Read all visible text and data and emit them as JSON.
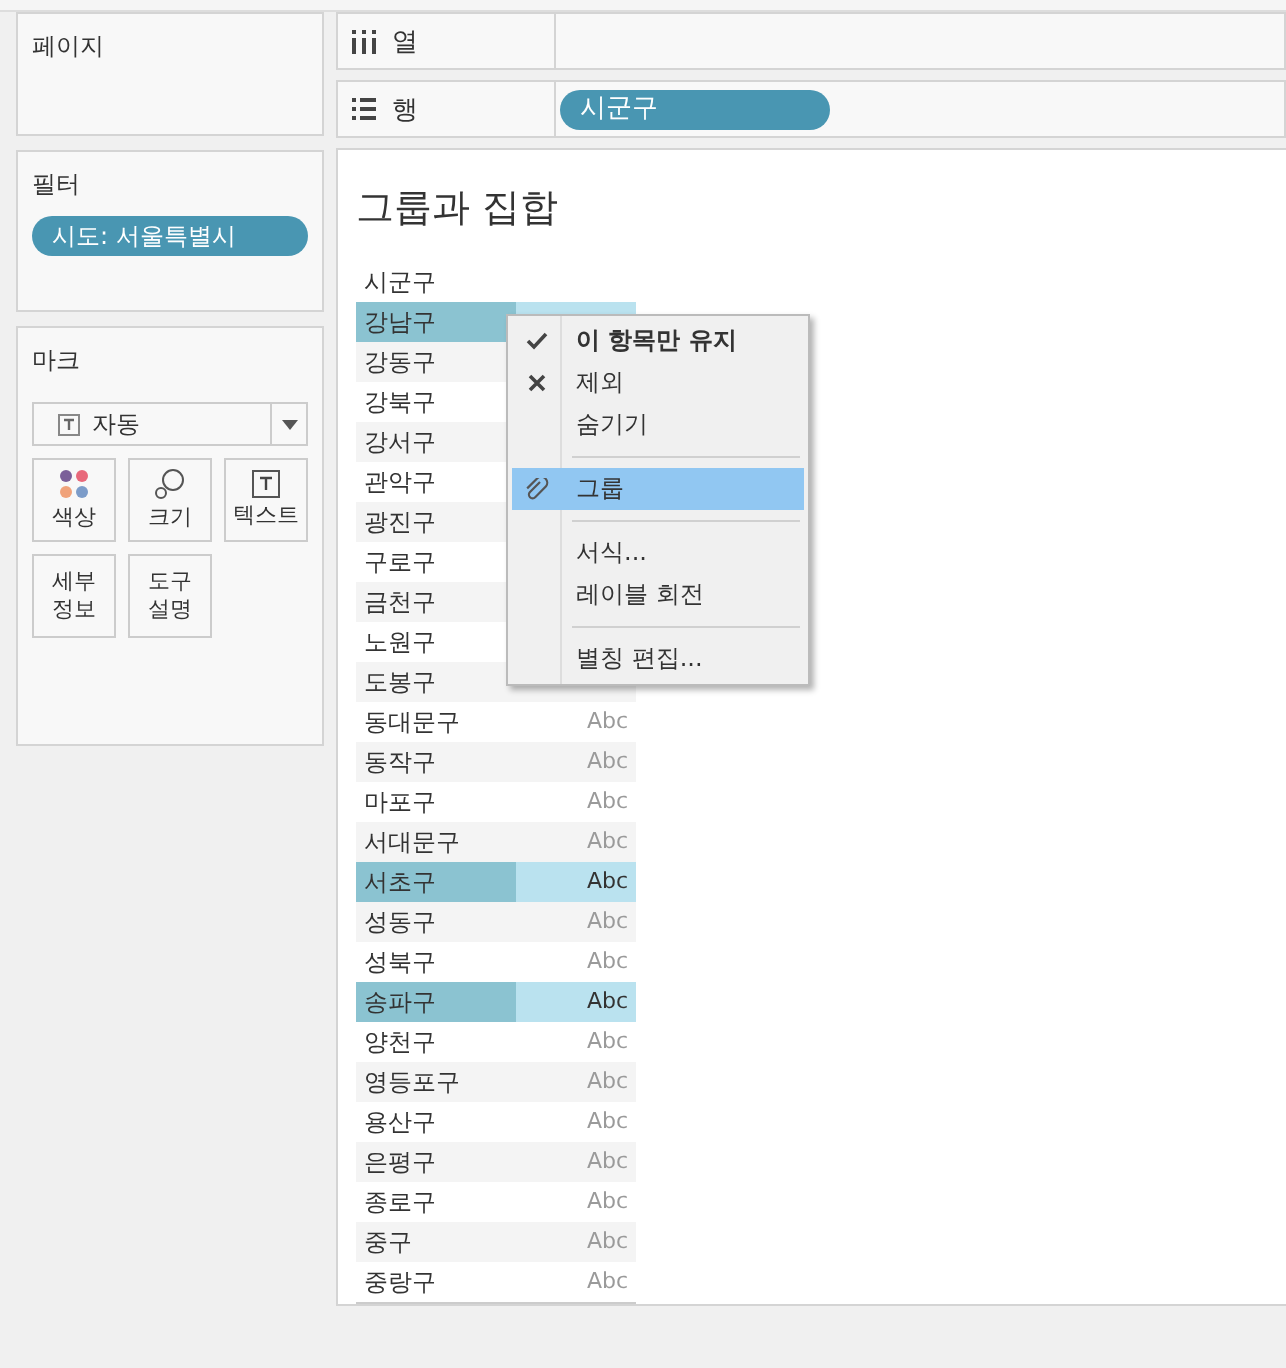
{
  "pages_panel": {
    "title": "페이지"
  },
  "shelves": [
    {
      "kind": "columns",
      "label": "열"
    },
    {
      "kind": "rows",
      "label": "행",
      "pill": "시군구"
    }
  ],
  "filters_panel": {
    "title": "필터",
    "pill": "시도: 서울특별시"
  },
  "marks_panel": {
    "title": "마크",
    "mark_type": "자동",
    "cards": [
      {
        "kind": "color",
        "label": "색상"
      },
      {
        "kind": "size",
        "label": "크기"
      },
      {
        "kind": "text",
        "label": "텍스트"
      },
      {
        "kind": "plain",
        "label": "세부\n정보"
      },
      {
        "kind": "plain",
        "label": "도구\n설명"
      }
    ]
  },
  "view": {
    "title": "그룹과 집합",
    "header": "시군구",
    "rows": [
      {
        "name": "강남구",
        "selected": true
      },
      {
        "name": "강동구",
        "selected": false
      },
      {
        "name": "강북구",
        "selected": false
      },
      {
        "name": "강서구",
        "selected": false
      },
      {
        "name": "관악구",
        "selected": false
      },
      {
        "name": "광진구",
        "selected": false
      },
      {
        "name": "구로구",
        "selected": false
      },
      {
        "name": "금천구",
        "selected": false
      },
      {
        "name": "노원구",
        "selected": false
      },
      {
        "name": "도봉구",
        "selected": false
      },
      {
        "name": "동대문구",
        "selected": false,
        "value": "Abc"
      },
      {
        "name": "동작구",
        "selected": false,
        "value": "Abc"
      },
      {
        "name": "마포구",
        "selected": false,
        "value": "Abc"
      },
      {
        "name": "서대문구",
        "selected": false,
        "value": "Abc"
      },
      {
        "name": "서초구",
        "selected": true,
        "value": "Abc"
      },
      {
        "name": "성동구",
        "selected": false,
        "value": "Abc"
      },
      {
        "name": "성북구",
        "selected": false,
        "value": "Abc"
      },
      {
        "name": "송파구",
        "selected": true,
        "value": "Abc"
      },
      {
        "name": "양천구",
        "selected": false,
        "value": "Abc"
      },
      {
        "name": "영등포구",
        "selected": false,
        "value": "Abc"
      },
      {
        "name": "용산구",
        "selected": false,
        "value": "Abc"
      },
      {
        "name": "은평구",
        "selected": false,
        "value": "Abc"
      },
      {
        "name": "종로구",
        "selected": false,
        "value": "Abc"
      },
      {
        "name": "중구",
        "selected": false,
        "value": "Abc"
      },
      {
        "name": "중랑구",
        "selected": false,
        "value": "Abc"
      }
    ]
  },
  "context_menu": [
    {
      "kind": "check",
      "label": "이 항목만 유지",
      "bold": true,
      "selected": false
    },
    {
      "kind": "cross",
      "label": "제외",
      "bold": false,
      "selected": false
    },
    {
      "kind": "plain",
      "label": "숨기기",
      "bold": false,
      "selected": false
    },
    {
      "kind": "separator"
    },
    {
      "kind": "clip",
      "label": "그룹",
      "bold": false,
      "selected": true
    },
    {
      "kind": "separator"
    },
    {
      "kind": "plain",
      "label": "서식...",
      "bold": false,
      "selected": false
    },
    {
      "kind": "plain",
      "label": "레이블 회전",
      "bold": false,
      "selected": false
    },
    {
      "kind": "separator"
    },
    {
      "kind": "plain",
      "label": "별칭 편집...",
      "bold": false,
      "selected": false
    }
  ]
}
